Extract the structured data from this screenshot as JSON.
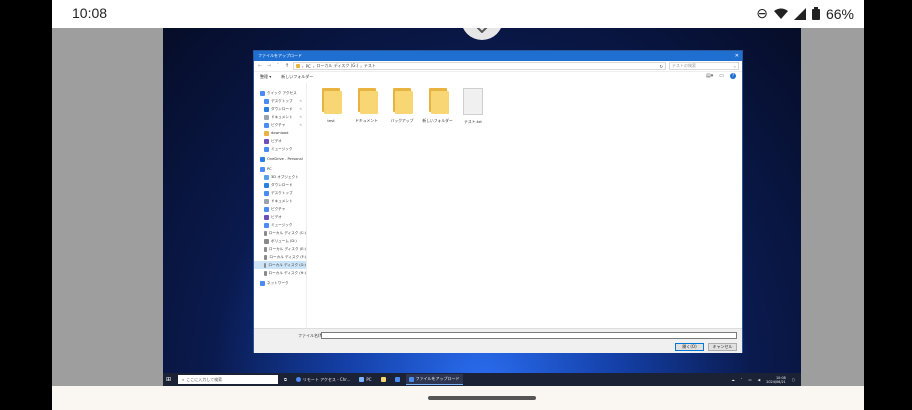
{
  "status_bar": {
    "time": "10:08",
    "battery": "66%"
  },
  "dialog": {
    "title": "ファイルをアップロード",
    "breadcrumb": [
      "PC",
      "ローカル ディスク (G:)",
      "テスト"
    ],
    "search_placeholder": "テストの検索",
    "toolbar": {
      "organize": "整理 ▾",
      "new_folder": "新しいフォルダー"
    },
    "nav_items": [
      {
        "label": "クイック アクセス",
        "icon": "star-icon",
        "level": "section"
      },
      {
        "label": "デスクトップ",
        "icon": "desktop-icon",
        "level": "sub",
        "pinned": true
      },
      {
        "label": "ダウンロード",
        "icon": "download-icon",
        "level": "sub",
        "pinned": true
      },
      {
        "label": "ドキュメント",
        "icon": "document-icon",
        "level": "sub",
        "pinned": true
      },
      {
        "label": "ピクチャ",
        "icon": "picture-icon",
        "level": "sub",
        "pinned": true
      },
      {
        "label": "download",
        "icon": "folder-icon",
        "level": "sub"
      },
      {
        "label": "ビデオ",
        "icon": "video-icon",
        "level": "sub"
      },
      {
        "label": "ミュージック",
        "icon": "music-icon",
        "level": "sub"
      },
      {
        "label": "OneDrive - Personal",
        "icon": "cloud-icon",
        "level": "section"
      },
      {
        "label": "PC",
        "icon": "pc-icon",
        "level": "section"
      },
      {
        "label": "3D オブジェクト",
        "icon": "cube-icon",
        "level": "sub"
      },
      {
        "label": "ダウンロード",
        "icon": "download-icon",
        "level": "sub"
      },
      {
        "label": "デスクトップ",
        "icon": "desktop-icon",
        "level": "sub"
      },
      {
        "label": "ドキュメント",
        "icon": "document-icon",
        "level": "sub"
      },
      {
        "label": "ピクチャ",
        "icon": "picture-icon",
        "level": "sub"
      },
      {
        "label": "ビデオ",
        "icon": "video-icon",
        "level": "sub"
      },
      {
        "label": "ミュージック",
        "icon": "music-icon",
        "level": "sub"
      },
      {
        "label": "ローカル ディスク (C:)",
        "icon": "drive-icon",
        "level": "sub"
      },
      {
        "label": "ボリューム (D:)",
        "icon": "drive-icon",
        "level": "sub"
      },
      {
        "label": "ローカル ディスク (E:)",
        "icon": "drive-icon",
        "level": "sub"
      },
      {
        "label": "ローカル ディスク (F:)",
        "icon": "drive-icon",
        "level": "sub"
      },
      {
        "label": "ローカル ディスク (G:)",
        "icon": "drive-icon",
        "level": "sub",
        "selected": true
      },
      {
        "label": "ローカル ディスク (H:)",
        "icon": "drive-icon",
        "level": "sub"
      },
      {
        "label": "ネットワーク",
        "icon": "network-icon",
        "level": "section"
      }
    ],
    "files": [
      {
        "name": "test",
        "type": "folder"
      },
      {
        "name": "ドキュメント",
        "type": "folder"
      },
      {
        "name": "バックアップ",
        "type": "folder"
      },
      {
        "name": "新しいフォルダー",
        "type": "folder"
      },
      {
        "name": "テスト.txt",
        "type": "text"
      }
    ],
    "filename_label": "ファイル名(N):",
    "filename_value": "",
    "open_button": "開く(O)",
    "cancel_button": "キャンセル"
  },
  "taskbar": {
    "search_placeholder": "ここに入力して検索",
    "apps": [
      {
        "label": "リモート アクセス - Chr...",
        "active": false
      },
      {
        "label": "PC",
        "active": false
      },
      {
        "label": "ファイルをアップロード",
        "active": true
      }
    ],
    "clock_time": "10:08",
    "clock_date": "2024/06/21"
  },
  "colors": {
    "accent": "#1f6fd1",
    "folder": "#f8d673",
    "selected": "#cce4f7"
  }
}
